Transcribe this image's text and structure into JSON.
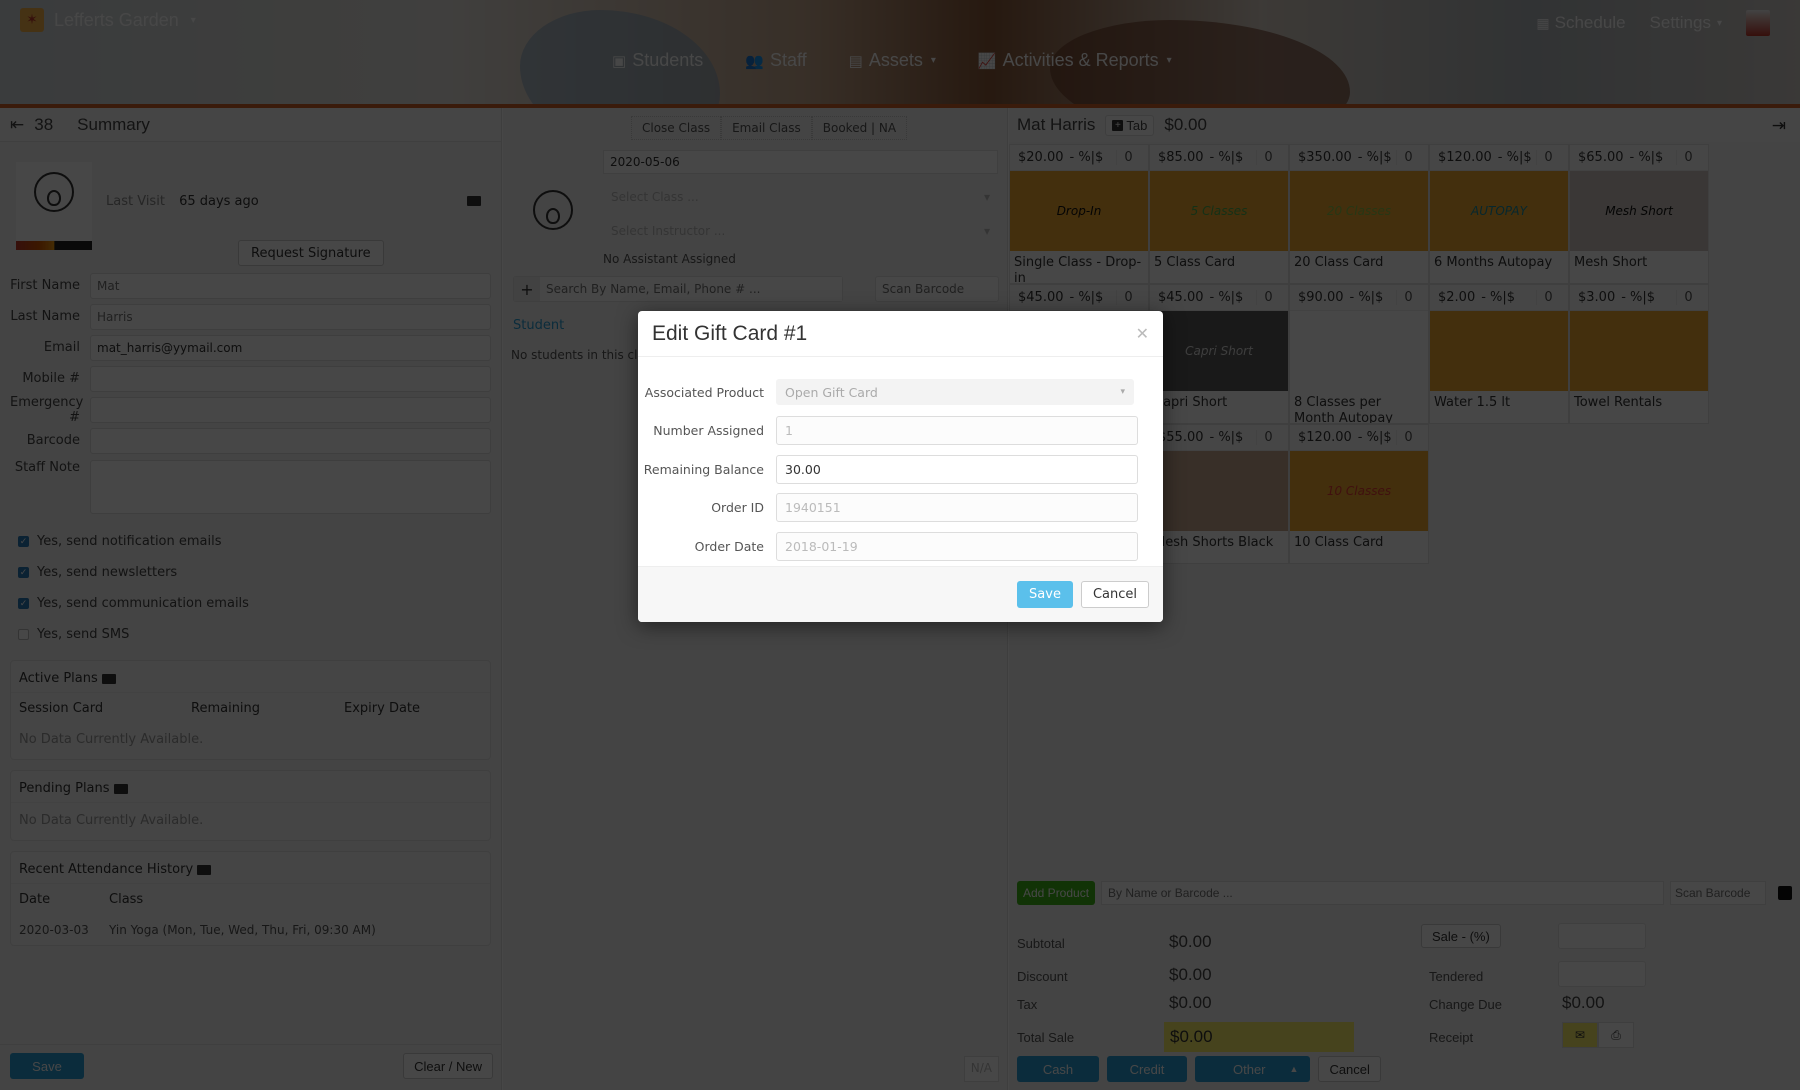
{
  "header": {
    "brand": "Lefferts Garden",
    "nav": [
      {
        "label": "Students",
        "icon": "id-card-icon"
      },
      {
        "label": "Staff",
        "icon": "users-icon"
      },
      {
        "label": "Assets",
        "icon": "briefcase-icon",
        "dropdown": true
      },
      {
        "label": "Activities & Reports",
        "icon": "line-chart-icon",
        "dropdown": true
      }
    ],
    "schedule_label": "Schedule",
    "settings_label": "Settings"
  },
  "left_panel": {
    "count": "38",
    "title": "Summary",
    "last_visit_label": "Last Visit",
    "last_visit_value": "65 days ago",
    "request_signature": "Request Signature",
    "fields": [
      {
        "label": "First Name",
        "value": "",
        "placeholder": "Mat"
      },
      {
        "label": "Last Name",
        "value": "",
        "placeholder": "Harris"
      },
      {
        "label": "Email",
        "value": "mat_harris@yymail.com",
        "placeholder": ""
      },
      {
        "label": "Mobile #",
        "value": "",
        "placeholder": ""
      },
      {
        "label": "Emergency #",
        "value": "",
        "placeholder": ""
      },
      {
        "label": "Barcode",
        "value": "",
        "placeholder": ""
      }
    ],
    "staff_note_label": "Staff Note",
    "checkboxes": [
      {
        "label": "Yes, send notification emails",
        "checked": true
      },
      {
        "label": "Yes, send newsletters",
        "checked": true
      },
      {
        "label": "Yes, send communication emails",
        "checked": true
      },
      {
        "label": "Yes, send SMS",
        "checked": false
      }
    ],
    "active_plans": {
      "title": "Active Plans",
      "columns": [
        "Session Card",
        "Remaining",
        "Expiry Date"
      ],
      "empty": "No Data Currently Available."
    },
    "pending_plans": {
      "title": "Pending Plans",
      "empty": "No Data Currently Available."
    },
    "attendance": {
      "title": "Recent Attendance History",
      "columns": [
        "Date",
        "Class"
      ],
      "rows": [
        {
          "date": "2020-03-03",
          "class": "Yin Yoga (Mon, Tue, Wed, Thu, Fri, 09:30 AM)"
        }
      ]
    },
    "save_label": "Save",
    "clear_label": "Clear / New"
  },
  "middle_panel": {
    "tabs": [
      "Close Class",
      "Email Class",
      "Booked | NA"
    ],
    "date": "2020-05-06",
    "select_class_placeholder": "Select Class ...",
    "select_instructor_placeholder": "Select Instructor ...",
    "no_assistant": "No Assistant Assigned",
    "search_placeholder": "Search By Name, Email, Phone # ...",
    "scan_placeholder": "Scan Barcode",
    "student_header": "Student",
    "no_students": "No students in this class",
    "na_label": "N/A"
  },
  "right_panel": {
    "customer": "Mat Harris",
    "tab_label": "Tab",
    "balance": "$0.00",
    "products": [
      {
        "price": "$20.00",
        "disc": "- %|$",
        "qty": "0",
        "name": "Single Class - Drop-in",
        "overlay": "Drop-In",
        "bg": "#f0a830",
        "fg": "#111"
      },
      {
        "price": "$85.00",
        "disc": "- %|$",
        "qty": "0",
        "name": "5 Class Card",
        "overlay": "5 Classes",
        "bg": "#f0a830",
        "fg": "#4caf50"
      },
      {
        "price": "$350.00",
        "disc": "- %|$",
        "qty": "0",
        "name": "20 Class Card",
        "overlay": "20 Classes",
        "bg": "#f0a830",
        "fg": "#8bc34a"
      },
      {
        "price": "$120.00",
        "disc": "- %|$",
        "qty": "0",
        "name": "6 Months Autopay",
        "overlay": "AUTOPAY",
        "bg": "#f0a830",
        "fg": "#1a8ca0"
      },
      {
        "price": "$65.00",
        "disc": "- %|$",
        "qty": "0",
        "name": "Mesh Short",
        "overlay": "Mesh Short",
        "bg": "#cfc7c0",
        "fg": "#111"
      },
      {
        "price": "$45.00",
        "disc": "- %|$",
        "qty": "0",
        "name": "",
        "overlay": "",
        "bg": "#d8d8d8",
        "fg": "#333"
      },
      {
        "price": "$45.00",
        "disc": "- %|$",
        "qty": "0",
        "name": "Capri Short",
        "overlay": "Capri Short",
        "bg": "#5a5a5a",
        "fg": "#ddd"
      },
      {
        "price": "$90.00",
        "disc": "- %|$",
        "qty": "0",
        "name": "8 Classes per Month Autopay",
        "overlay": "",
        "bg": "#ffffff",
        "fg": "#2a9fd6"
      },
      {
        "price": "$2.00",
        "disc": "- %|$",
        "qty": "0",
        "name": "Water 1.5 lt",
        "overlay": "",
        "bg": "#f0a830",
        "fg": "#cde"
      },
      {
        "price": "$3.00",
        "disc": "- %|$",
        "qty": "0",
        "name": "Towel Rentals",
        "overlay": "",
        "bg": "#f0a830",
        "fg": "#eee"
      },
      {
        "price": "",
        "disc": "",
        "qty": "",
        "name": "",
        "overlay": "",
        "bg": "#d8d8d8",
        "fg": "#333"
      },
      {
        "price": "$55.00",
        "disc": "- %|$",
        "qty": "0",
        "name": "Mesh Shorts Black",
        "overlay": "",
        "bg": "#c9a990",
        "fg": "#1a2340"
      },
      {
        "price": "$120.00",
        "disc": "- %|$",
        "qty": "0",
        "name": "10 Class Card",
        "overlay": "10 Classes",
        "bg": "#f0a830",
        "fg": "#e53935"
      }
    ],
    "add_product_label": "Add Product",
    "add_product_placeholder": "By Name or Barcode ...",
    "scan_placeholder": "Scan Barcode",
    "totals": {
      "subtotal_label": "Subtotal",
      "subtotal": "$0.00",
      "discount_label": "Discount",
      "discount": "$0.00",
      "tax_label": "Tax",
      "tax": "$0.00",
      "total_label": "Total Sale",
      "total": "$0.00",
      "sale_pct_label": "Sale - (%)",
      "tendered_label": "Tendered",
      "change_due_label": "Change Due",
      "change_due": "$0.00",
      "receipt_label": "Receipt"
    },
    "pay_buttons": {
      "cash": "Cash",
      "credit": "Credit",
      "other": "Other",
      "cancel": "Cancel"
    }
  },
  "modal": {
    "title": "Edit Gift Card #1",
    "fields": {
      "associated_product_label": "Associated Product",
      "associated_product_value": "Open Gift Card",
      "number_assigned_label": "Number Assigned",
      "number_assigned_value": "1",
      "remaining_balance_label": "Remaining Balance",
      "remaining_balance_value": "30.00",
      "order_id_label": "Order ID",
      "order_id_value": "1940151",
      "order_date_label": "Order Date",
      "order_date_value": "2018-01-19"
    },
    "save_label": "Save",
    "cancel_label": "Cancel"
  },
  "colors": {
    "accent_blue": "#2a9fd6",
    "modal_save": "#5bc0eb",
    "add_product_green": "#3fb618",
    "total_highlight": "#fbf069",
    "header_stripe": "#d1622a"
  }
}
